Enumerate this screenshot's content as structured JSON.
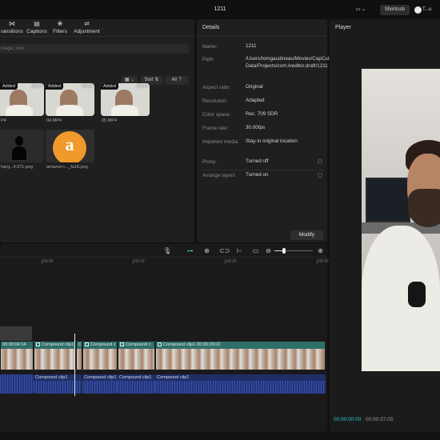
{
  "window": {
    "title": "1211",
    "shortcuts_label": "Shortcuts",
    "profile_label": "T...u"
  },
  "media": {
    "tabs": [
      {
        "label": "ransitions",
        "icon": "transitions-icon"
      },
      {
        "label": "Captions",
        "icon": "captions-icon"
      },
      {
        "label": "Filters",
        "icon": "filters-icon"
      },
      {
        "label": "Adjustment",
        "icon": "adjustment-icon"
      }
    ],
    "search_placeholder": "mage, mes",
    "sort_label": "Sort",
    "all_label": "All",
    "items": [
      {
        "label": "P4",
        "badge": "Added",
        "duration": "00:07"
      },
      {
        "label": "04.MP4",
        "badge": "Added",
        "duration": "00:16"
      },
      {
        "label": "05.MP4",
        "badge": "Added",
        "duration": "00:13"
      },
      {
        "label": "harg...4.971.png"
      },
      {
        "label": "amazon-i..._fa18.png"
      }
    ]
  },
  "details": {
    "title": "Details",
    "rows": [
      {
        "label": "Name:",
        "value": "1211"
      },
      {
        "label": "Path:",
        "value": "/Users/tomgaudineau/Movies/CapCut/User Data/Projects/com.lveditor.draft/1211"
      },
      {
        "label": "Aspect ratio:",
        "value": "Original"
      },
      {
        "label": "Resolution:",
        "value": "Adapted"
      },
      {
        "label": "Color space:",
        "value": "Rec. 709 SDR"
      },
      {
        "label": "Frame rate:",
        "value": "30.00fps"
      },
      {
        "label": "Imported media:",
        "value": "Stay in original location"
      },
      {
        "label": "Proxy:",
        "value": "Turned off"
      },
      {
        "label": "Arrange layers",
        "value": "Turned on"
      }
    ],
    "modify_label": "Modify"
  },
  "player": {
    "title": "Player",
    "current_time": "00:00:00:00",
    "total_time": "00:00:37:05"
  },
  "timeline": {
    "ruler": [
      "00:05",
      "00:10",
      "00:15",
      "00:20"
    ],
    "zoom_fraction": 0.25,
    "clips": [
      {
        "label": "00:00:04:14"
      },
      {
        "label": "Compound clip1"
      },
      {
        "label": "Co"
      },
      {
        "label": "Compound c"
      },
      {
        "label": "Compound c"
      },
      {
        "label": "Compound clip1  00:00:26:02"
      }
    ],
    "audio_clips": [
      "Compound clip1",
      "Compound clip1",
      "Compound clip1",
      "Compound clip1"
    ]
  },
  "colors": {
    "accent": "#37c8c8",
    "video_track": "#1f5d5a",
    "audio_track": "#24357a"
  }
}
